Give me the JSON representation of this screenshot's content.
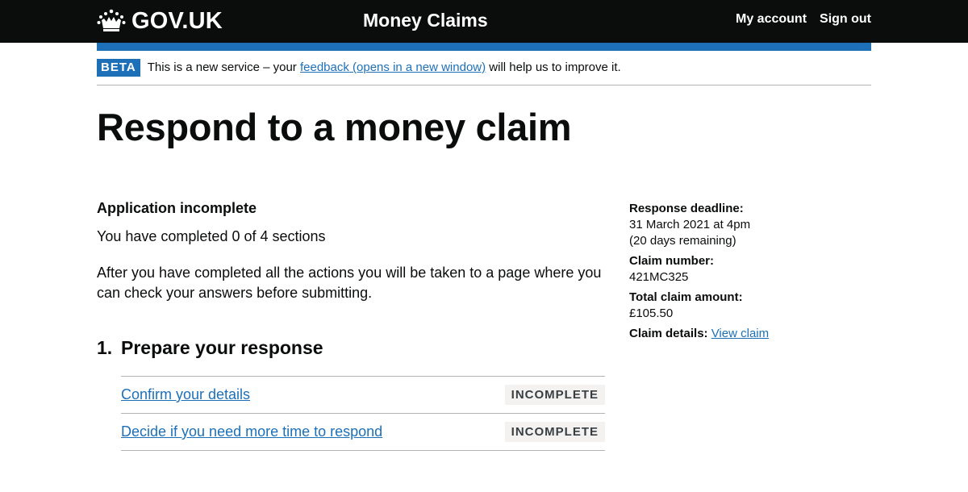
{
  "header": {
    "logo_text": "GOV.UK",
    "service_name": "Money Claims",
    "nav": {
      "my_account": "My account",
      "sign_out": "Sign out"
    },
    "colors": {
      "background": "#0b0c0c",
      "accent": "#1d70b8"
    }
  },
  "phase_banner": {
    "tag": "BETA",
    "text_before": "This is a new service – your ",
    "link_text": "feedback (opens in a new window)",
    "text_after": " will help us to improve it."
  },
  "page": {
    "title": "Respond to a money claim",
    "status_heading": "Application incomplete",
    "status_text": "You have completed 0 of 4 sections",
    "intro": "After you have completed all the actions you will be taken to a page where you can check your answers before submitting."
  },
  "sections": [
    {
      "number": "1.",
      "title": "Prepare your response",
      "tasks": [
        {
          "label": "Confirm your details",
          "status": "INCOMPLETE"
        },
        {
          "label": "Decide if you need more time to respond",
          "status": "INCOMPLETE"
        }
      ]
    }
  ],
  "sidebar": {
    "deadline_label": "Response deadline:",
    "deadline_value": "31 March 2021 at 4pm",
    "deadline_remaining": "(20 days remaining)",
    "claim_number_label": "Claim number:",
    "claim_number_value": "421MC325",
    "amount_label": "Total claim amount:",
    "amount_value": "£105.50",
    "details_label": "Claim details:",
    "details_link": "View claim"
  }
}
